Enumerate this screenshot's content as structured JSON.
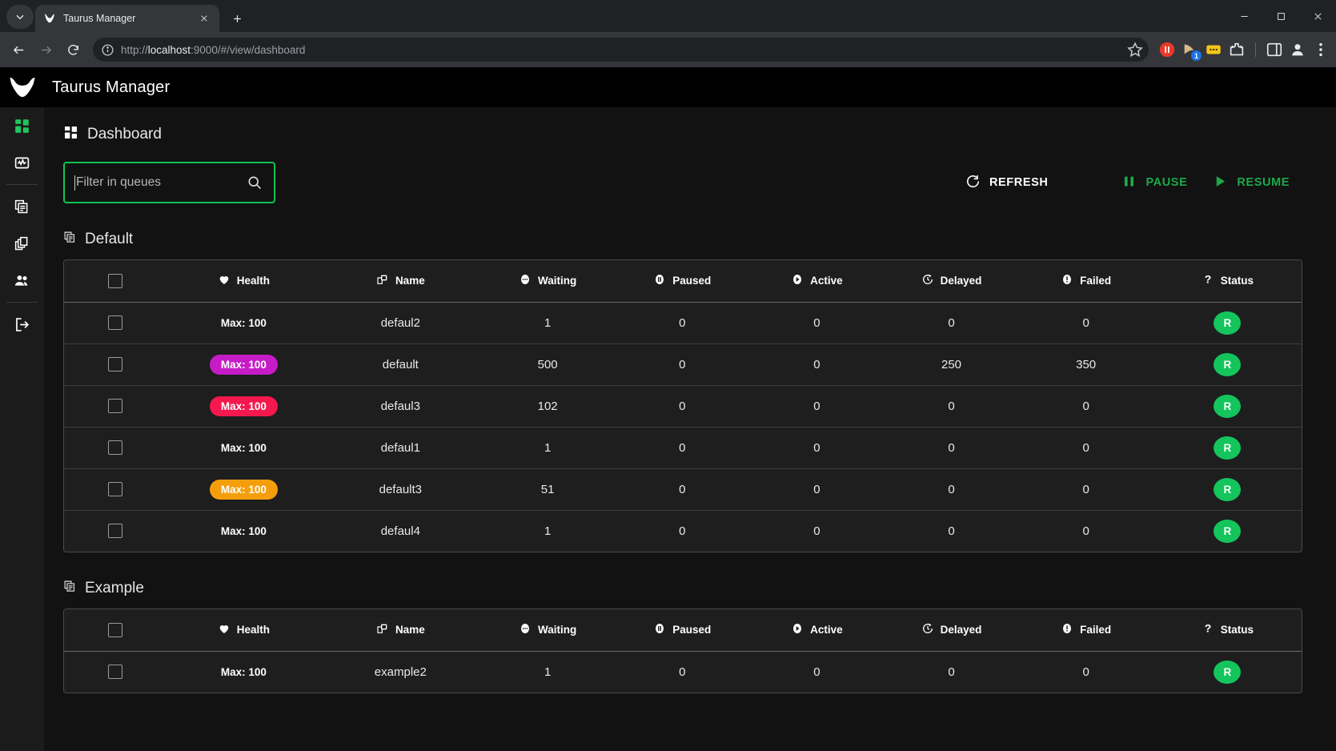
{
  "browser": {
    "tab": {
      "title": "Taurus Manager",
      "favicon": "taurus-logo-icon",
      "close": "×"
    },
    "new_tab_label": "+",
    "url_prefix": "http://",
    "url_host": "localhost",
    "url_rest": ":9000/#/view/dashboard",
    "extensions": [
      {
        "name": "adblock-icon",
        "color": "#e8392b"
      },
      {
        "name": "extension-badge-icon",
        "color": "#d7b98a",
        "badge": "1",
        "badge_color": "#1a73e8"
      },
      {
        "name": "notes-extension-icon",
        "color": "#f5c518"
      },
      {
        "name": "puzzle-extension-icon",
        "color": "#ffffff"
      }
    ],
    "window_controls": {
      "minimize": "minimize-icon",
      "maximize": "maximize-icon",
      "close": "close-icon"
    }
  },
  "app": {
    "title": "Taurus Manager",
    "logo_icon": "bull-head-icon",
    "menu_icon": "hamburger-menu-icon",
    "rail": [
      {
        "icon": "dashboard-grid-icon",
        "name": "dashboard",
        "active": true
      },
      {
        "icon": "monitoring-activity-icon",
        "name": "monitoring",
        "active": false
      },
      {
        "icon": "queues-stack-icon",
        "name": "queues",
        "active": false
      },
      {
        "icon": "layers-copy-icon",
        "name": "groups",
        "active": false
      },
      {
        "icon": "users-people-icon",
        "name": "users",
        "active": false
      },
      {
        "icon": "logout-arrow-icon",
        "name": "logout",
        "active": false
      }
    ]
  },
  "page": {
    "title": "Dashboard",
    "title_icon": "dashboard-grid-icon"
  },
  "filter": {
    "placeholder": "Filter in queues",
    "value": "",
    "search_icon": "search-icon"
  },
  "toolbar": {
    "refresh_label": "REFRESH",
    "refresh_icon": "refresh-icon",
    "pause_label": "PAUSE",
    "pause_icon": "pause-icon",
    "resume_label": "RESUME",
    "resume_icon": "play-icon",
    "refresh_color": "#ffffff",
    "pause_color": "#1ea84a",
    "resume_color": "#1ea84a"
  },
  "columns": [
    {
      "label": "Health",
      "icon": "heart-icon"
    },
    {
      "label": "Name",
      "icon": "label-tag-icon"
    },
    {
      "label": "Waiting",
      "icon": "dots-circle-icon"
    },
    {
      "label": "Paused",
      "icon": "pause-circle-icon"
    },
    {
      "label": "Active",
      "icon": "play-circle-icon"
    },
    {
      "label": "Delayed",
      "icon": "timer-clock-icon"
    },
    {
      "label": "Failed",
      "icon": "error-exclamation-icon"
    },
    {
      "label": "Status",
      "icon": "question-mark-icon"
    }
  ],
  "badge_colors": {
    "green": "#13c55",
    "magenta": "#c71bc7",
    "red": "#f4184f",
    "orange": "#f59e0b"
  },
  "status_color": "#13c55c",
  "groups": [
    {
      "name": "Default",
      "icon": "queues-stack-icon",
      "rows": [
        {
          "health": "Max: 100",
          "health_color": "green",
          "name": "defaul2",
          "waiting": "1",
          "paused": "0",
          "active": "0",
          "delayed": "0",
          "failed": "0",
          "status": "R"
        },
        {
          "health": "Max: 100",
          "health_color": "magenta",
          "name": "default",
          "waiting": "500",
          "paused": "0",
          "active": "0",
          "delayed": "250",
          "failed": "350",
          "status": "R"
        },
        {
          "health": "Max: 100",
          "health_color": "red",
          "name": "defaul3",
          "waiting": "102",
          "paused": "0",
          "active": "0",
          "delayed": "0",
          "failed": "0",
          "status": "R"
        },
        {
          "health": "Max: 100",
          "health_color": "green",
          "name": "defaul1",
          "waiting": "1",
          "paused": "0",
          "active": "0",
          "delayed": "0",
          "failed": "0",
          "status": "R"
        },
        {
          "health": "Max: 100",
          "health_color": "orange",
          "name": "default3",
          "waiting": "51",
          "paused": "0",
          "active": "0",
          "delayed": "0",
          "failed": "0",
          "status": "R"
        },
        {
          "health": "Max: 100",
          "health_color": "green",
          "name": "defaul4",
          "waiting": "1",
          "paused": "0",
          "active": "0",
          "delayed": "0",
          "failed": "0",
          "status": "R"
        }
      ]
    },
    {
      "name": "Example",
      "icon": "queues-stack-icon",
      "rows": [
        {
          "health": "Max: 100",
          "health_color": "green",
          "name": "example2",
          "waiting": "1",
          "paused": "0",
          "active": "0",
          "delayed": "0",
          "failed": "0",
          "status": "R"
        }
      ]
    }
  ]
}
